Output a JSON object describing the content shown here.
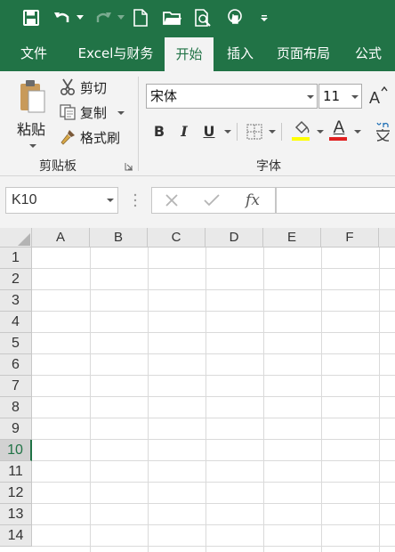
{
  "quick_access": {
    "icons": [
      "save-icon",
      "undo-icon",
      "redo-icon",
      "new-document-icon",
      "open-folder-icon",
      "print-preview-icon",
      "touch-mode-icon",
      "customize-toolbar-icon"
    ]
  },
  "tabs": [
    {
      "label": "文件"
    },
    {
      "label": "Excel与财务"
    },
    {
      "label": "开始"
    },
    {
      "label": "插入"
    },
    {
      "label": "页面布局"
    },
    {
      "label": "公式"
    }
  ],
  "ribbon": {
    "clipboard": {
      "paste": "粘贴",
      "cut": "剪切",
      "copy": "复制",
      "format_painter": "格式刷",
      "group_label": "剪贴板"
    },
    "font": {
      "font_name": "宋体",
      "font_size": "11",
      "bold": "B",
      "italic": "I",
      "underline": "U",
      "font_color_letter": "A",
      "highlight_color": "#ffff00",
      "font_color": "#e02020",
      "group_label": "字体"
    }
  },
  "formula_bar": {
    "name_box": "K10",
    "formula": "",
    "fx_label": "fx"
  },
  "grid": {
    "columns": [
      "A",
      "B",
      "C",
      "D",
      "E",
      "F"
    ],
    "rows": [
      "1",
      "2",
      "3",
      "4",
      "5",
      "6",
      "7",
      "8",
      "9",
      "10",
      "11",
      "12",
      "13",
      "14"
    ],
    "selected_row": "10",
    "selected_cell": "K10"
  },
  "colors": {
    "brand": "#217346",
    "ribbon_bg": "#f3f3f3",
    "header_bg": "#e9e9e9",
    "gridline": "#dadada"
  }
}
